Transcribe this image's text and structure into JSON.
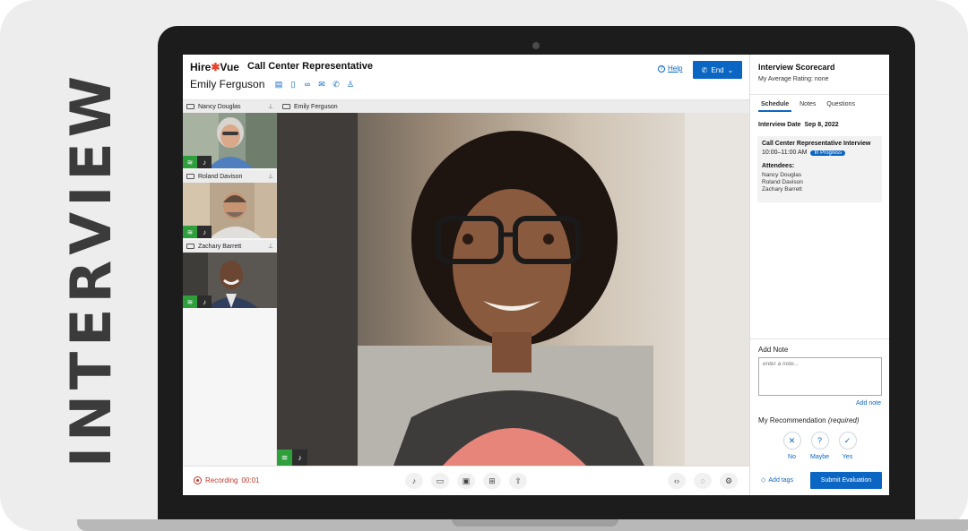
{
  "side_label": "INTERVIEW",
  "header": {
    "logo_left": "Hire",
    "logo_star": "✱",
    "logo_right": "Vue",
    "role_title": "Call Center Representative",
    "candidate_name": "Emily Ferguson",
    "candidate_icons": [
      "document-icon",
      "file-icon",
      "link-icon",
      "mail-icon",
      "phone-icon",
      "user-icon"
    ],
    "help_label": "Help",
    "end_label": "End"
  },
  "participants": [
    {
      "name": "Nancy Douglas"
    },
    {
      "name": "Roland Davison"
    },
    {
      "name": "Zachary Barrett"
    }
  ],
  "main_video": {
    "name": "Emily Ferguson"
  },
  "toolbar": {
    "recording_label": "Recording",
    "recording_time": "00:01"
  },
  "scorecard": {
    "title": "Interview Scorecard",
    "rating": "My Average Rating: none",
    "tabs": [
      "Schedule",
      "Notes",
      "Questions"
    ],
    "active_tab": "Schedule",
    "interview_date_label": "Interview Date",
    "interview_date": "Sep 8, 2022",
    "meeting_title": "Call Center Representative Interview",
    "meeting_time": "10:00–11:00 AM",
    "meeting_status": "In Progress",
    "attendees_label": "Attendees:",
    "attendees": [
      "Nancy Douglas",
      "Roland Davison",
      "Zachary Barrett"
    ],
    "add_note_label": "Add Note",
    "note_placeholder": "enter a note...",
    "add_note_link": "Add note",
    "recommendation_label": "My Recommendation",
    "recommendation_required": "(required)",
    "options": [
      "No",
      "Maybe",
      "Yes"
    ],
    "add_tags": "Add tags",
    "submit_label": "Submit Evaluation"
  },
  "colors": {
    "accent": "#0b66c3",
    "recording": "#c0392b",
    "status_green": "#2e9f3b"
  }
}
